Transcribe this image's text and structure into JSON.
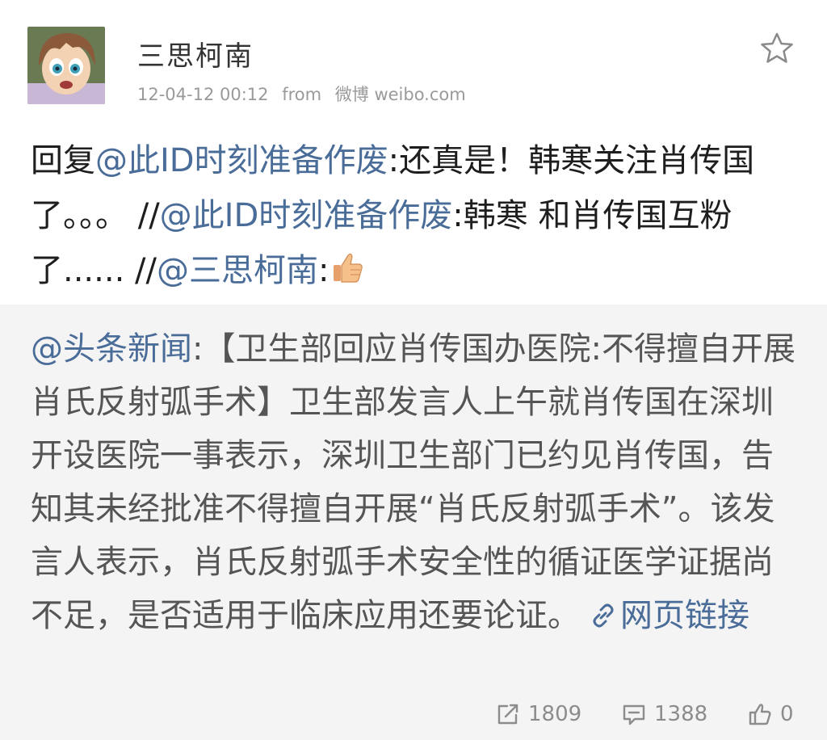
{
  "user": {
    "name": "三思柯南",
    "timestamp": "12-04-12 00:12",
    "from_label": "from",
    "source": "微博 weibo.com"
  },
  "post": {
    "line1_a": "回复",
    "mention1": "@此ID时刻准备作废",
    "line1_b": ":还真是！韩寒关注",
    "line2_a": "肖传国了。。。 //",
    "mention2": "@此ID时刻准备作废",
    "line2_b": ":韩寒",
    "line3_a": "和肖传国互粉了...... //",
    "mention3": "@三思柯南",
    "line3_b": ":",
    "emoji": "thumbs-up-emoji"
  },
  "repost": {
    "mention": "@头条新闻",
    "text": ":【卫生部回应肖传国办医院:不得擅自开展肖氏反射弧手术】卫生部发言人上午就肖传国在深圳开设医院一事表示，深圳卫生部门已约见肖传国，告知其未经批准不得擅自开展“肖氏反射弧手术”。该发言人表示，肖氏反射弧手术安全性的循证医学证据尚不足，是否适用于临床应用还要论证。",
    "link_label": "网页链接",
    "link_icon": "link-icon"
  },
  "actions": {
    "repost_count": "1809",
    "comment_count": "1388",
    "like_count": "0"
  },
  "colors": {
    "mention": "#4a6c98",
    "repost_bg": "#f4f4f4",
    "meta": "#9a9a9a"
  }
}
